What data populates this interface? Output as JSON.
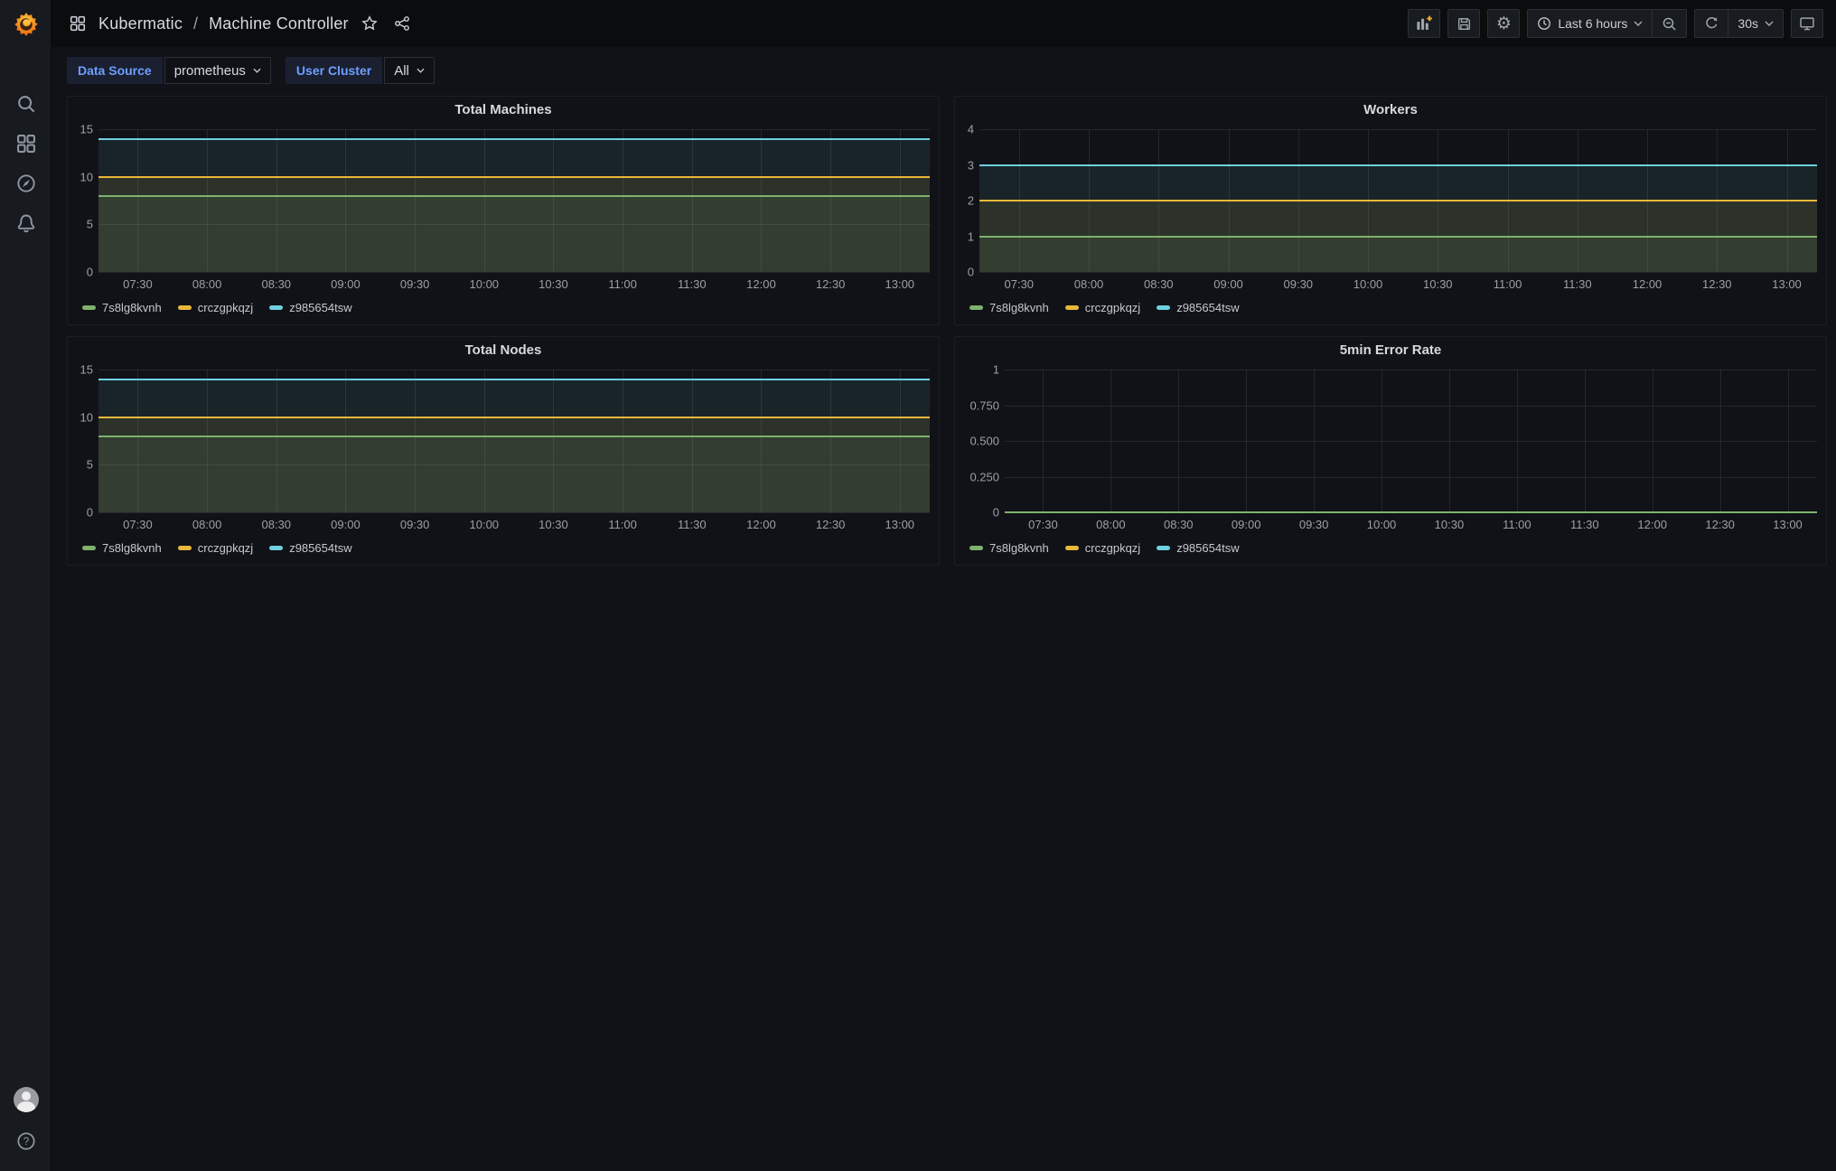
{
  "window": {
    "title": "Kubermatic / Machine Controller"
  },
  "sidebar": {
    "logo": "grafana-logo",
    "top_items": [
      {
        "name": "search",
        "icon": "search-icon"
      },
      {
        "name": "dashboards",
        "icon": "apps-grid-icon"
      },
      {
        "name": "explore",
        "icon": "compass-icon"
      },
      {
        "name": "alerting",
        "icon": "bell-icon"
      }
    ],
    "bottom_items": [
      {
        "name": "profile",
        "icon": "avatar"
      },
      {
        "name": "help",
        "icon": "help-icon"
      }
    ]
  },
  "header": {
    "breadcrumb": {
      "dashboard": "Kubermatic",
      "separator": "/",
      "page": "Machine Controller"
    },
    "toolbar": {
      "add_panel_icon": "bar-chart-plus-icon",
      "save_icon": "floppy-icon",
      "settings_icon": "gear-icon",
      "time_range_label": "Last 6 hours",
      "zoom_out_icon": "magnifier-minus-icon",
      "refresh_icon": "refresh-icon",
      "refresh_interval": "30s",
      "tv_icon": "monitor-icon"
    }
  },
  "variables": [
    {
      "label": "Data Source",
      "value": "prometheus"
    },
    {
      "label": "User Cluster",
      "value": "All"
    }
  ],
  "colors": {
    "green": "#7eb26d",
    "yellow": "#eab839",
    "cyan": "#6ed0e0",
    "accent_blue": "#6e9fff",
    "orange_plus": "#f5a623"
  },
  "chart_data": [
    {
      "type": "line",
      "title": "Total Machines",
      "x": [
        "07:30",
        "08:00",
        "08:30",
        "09:00",
        "09:30",
        "10:00",
        "10:30",
        "11:00",
        "11:30",
        "12:00",
        "12:30",
        "13:00"
      ],
      "x_window": "Last 6 hours",
      "series": [
        {
          "name": "7s8lg8kvnh",
          "color": "#7eb26d",
          "value": 8
        },
        {
          "name": "crczgpkqzj",
          "color": "#eab839",
          "value": 10
        },
        {
          "name": "z985654tsw",
          "color": "#6ed0e0",
          "value": 14
        }
      ],
      "series_shape": "constant-horizontal-lines-with-area-fill",
      "ylim": [
        0,
        15
      ],
      "yticks": [
        "0",
        "5",
        "10",
        "15"
      ],
      "grid": true,
      "legend_position": "bottom"
    },
    {
      "type": "line",
      "title": "Workers",
      "x": [
        "07:30",
        "08:00",
        "08:30",
        "09:00",
        "09:30",
        "10:00",
        "10:30",
        "11:00",
        "11:30",
        "12:00",
        "12:30",
        "13:00"
      ],
      "x_window": "Last 6 hours",
      "series": [
        {
          "name": "7s8lg8kvnh",
          "color": "#7eb26d",
          "value": 1
        },
        {
          "name": "crczgpkqzj",
          "color": "#eab839",
          "value": 2
        },
        {
          "name": "z985654tsw",
          "color": "#6ed0e0",
          "value": 3
        }
      ],
      "series_shape": "constant-horizontal-lines-with-area-fill",
      "ylim": [
        0,
        4
      ],
      "yticks": [
        "0",
        "1",
        "2",
        "3",
        "4"
      ],
      "grid": true,
      "legend_position": "bottom"
    },
    {
      "type": "line",
      "title": "Total Nodes",
      "x": [
        "07:30",
        "08:00",
        "08:30",
        "09:00",
        "09:30",
        "10:00",
        "10:30",
        "11:00",
        "11:30",
        "12:00",
        "12:30",
        "13:00"
      ],
      "x_window": "Last 6 hours",
      "series": [
        {
          "name": "7s8lg8kvnh",
          "color": "#7eb26d",
          "value": 8
        },
        {
          "name": "crczgpkqzj",
          "color": "#eab839",
          "value": 10
        },
        {
          "name": "z985654tsw",
          "color": "#6ed0e0",
          "value": 14
        }
      ],
      "series_shape": "constant-horizontal-lines-with-area-fill",
      "ylim": [
        0,
        15
      ],
      "yticks": [
        "0",
        "5",
        "10",
        "15"
      ],
      "grid": true,
      "legend_position": "bottom"
    },
    {
      "type": "line",
      "title": "5min Error Rate",
      "x": [
        "07:30",
        "08:00",
        "08:30",
        "09:00",
        "09:30",
        "10:00",
        "10:30",
        "11:00",
        "11:30",
        "12:00",
        "12:30",
        "13:00"
      ],
      "x_window": "Last 6 hours",
      "series": [
        {
          "name": "7s8lg8kvnh",
          "color": "#7eb26d",
          "value": 0
        },
        {
          "name": "crczgpkqzj",
          "color": "#eab839",
          "value": 0
        },
        {
          "name": "z985654tsw",
          "color": "#6ed0e0",
          "value": 0
        }
      ],
      "series_shape": "constant-horizontal-lines-with-area-fill",
      "ylim": [
        0,
        1
      ],
      "yticks": [
        "0",
        "0.250",
        "0.500",
        "0.750",
        "1"
      ],
      "grid": true,
      "legend_position": "bottom"
    }
  ]
}
